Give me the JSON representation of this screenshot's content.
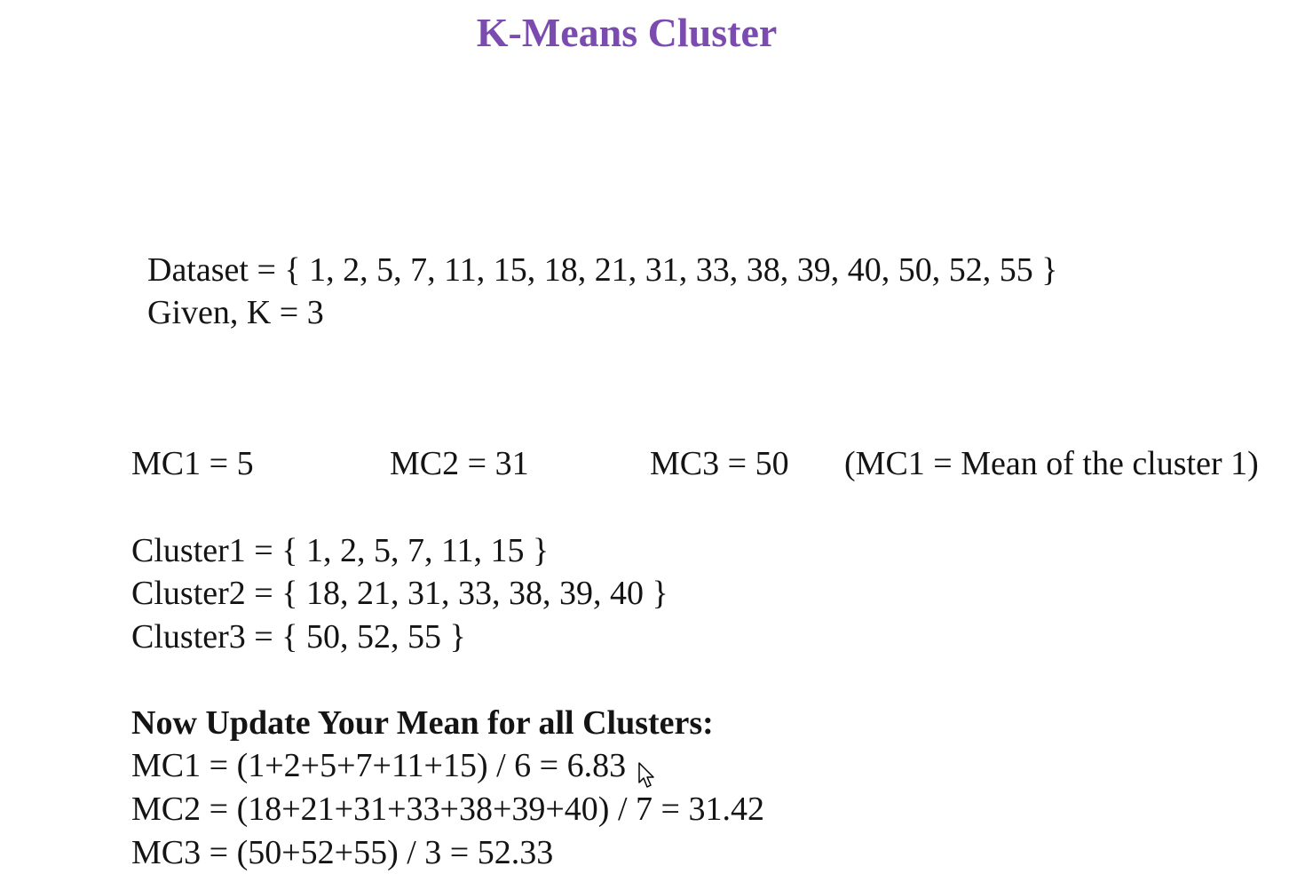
{
  "title": "K-Means Cluster",
  "problem": {
    "dataset": "Dataset = { 1, 2, 5, 7, 11, 15, 18, 21, 31, 33, 38, 39, 40, 50, 52, 55 }",
    "given": "Given, K = 3"
  },
  "initial_means": {
    "mc1": "MC1 = 5",
    "mc2": "MC2 = 31",
    "mc3": "MC3 = 50",
    "note": "(MC1 = Mean of the cluster 1)"
  },
  "clusters": {
    "cluster1": "Cluster1 = { 1, 2, 5, 7, 11, 15 }",
    "cluster2": "Cluster2 = { 18, 21, 31, 33, 38, 39, 40 }",
    "cluster3": "Cluster3 = { 50, 52, 55 }"
  },
  "update": {
    "heading": "Now Update Your Mean for all Clusters:",
    "mc1": "MC1 = (1+2+5+7+11+15) / 6  = 6.83",
    "mc2": "MC2 = (18+21+31+33+38+39+40) / 7 = 31.42",
    "mc3": "MC3 = (50+52+55) / 3 = 52.33"
  },
  "colors": {
    "title": "#7b4bb0",
    "text": "#141414",
    "background": "#ffffff"
  },
  "icons": {
    "cursor": "mouse-pointer-icon"
  }
}
